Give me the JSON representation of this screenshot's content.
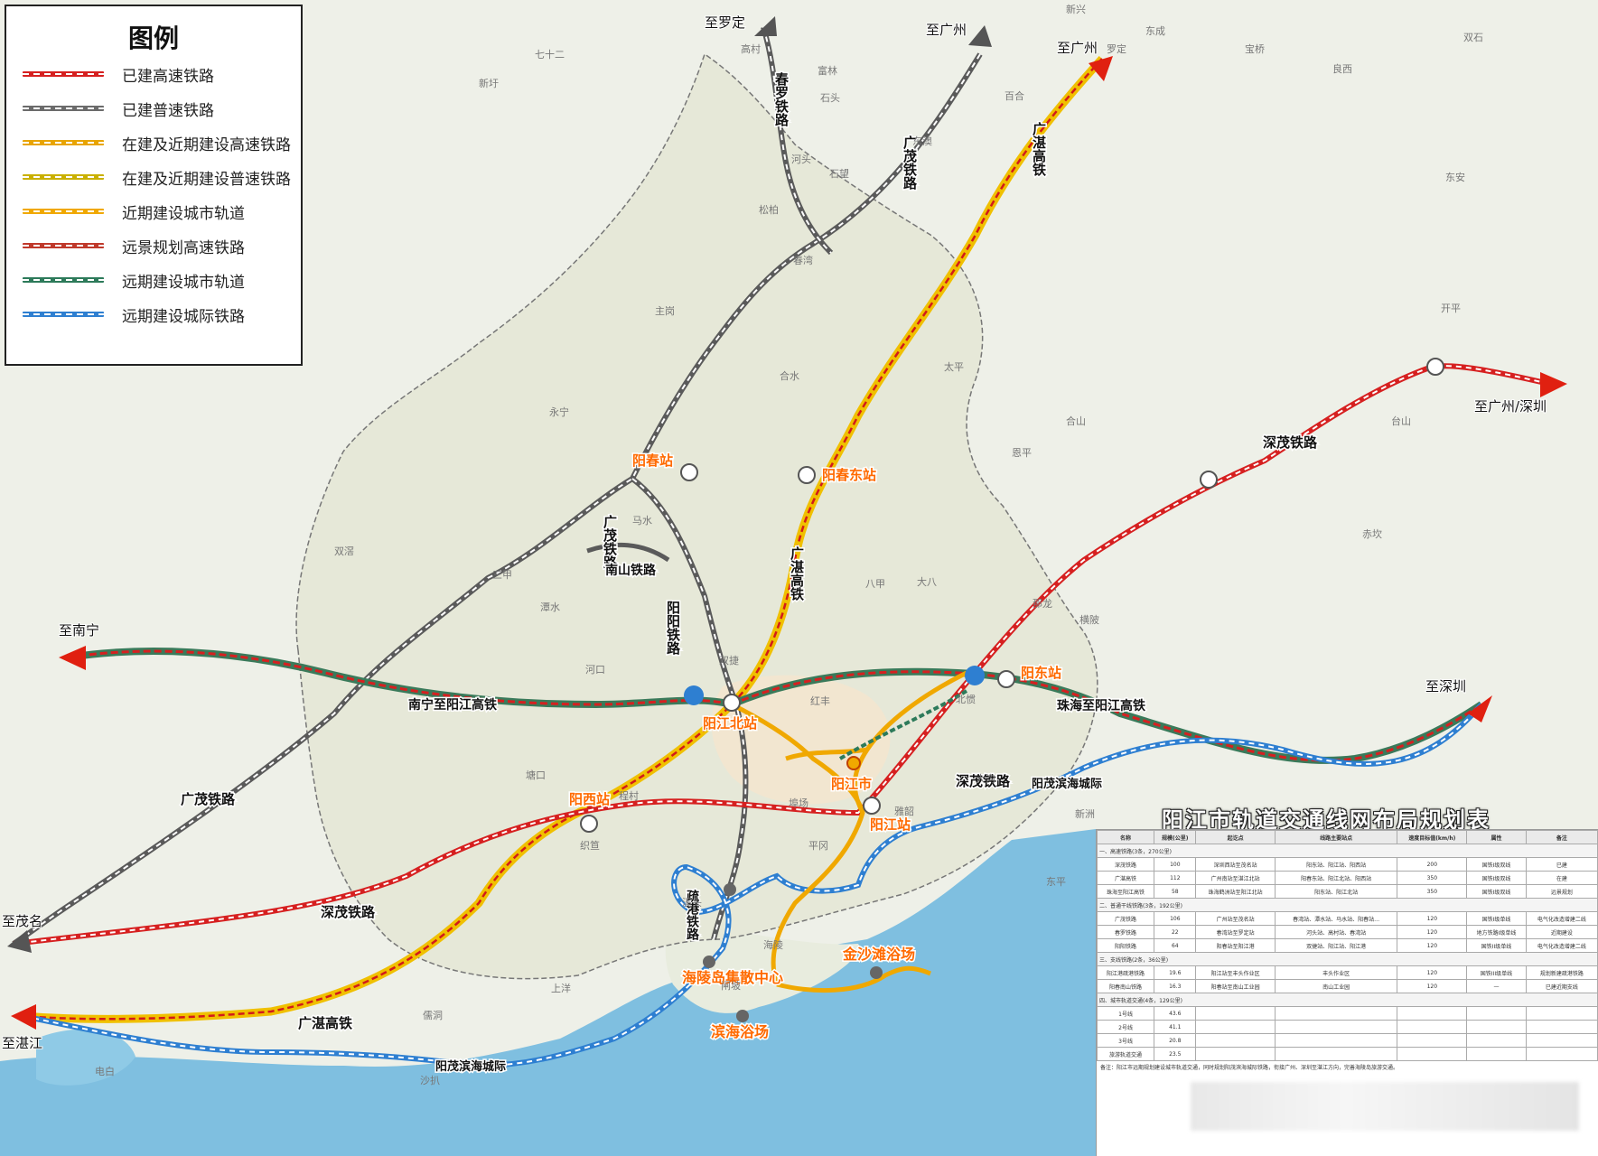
{
  "legend": {
    "title": "图例",
    "items": [
      {
        "label": "已建高速铁路",
        "color": "#d62020"
      },
      {
        "label": "已建普速铁路",
        "color": "#6b6b6b"
      },
      {
        "label": "在建及近期建设高速铁路",
        "color": "#e8a400"
      },
      {
        "label": "在建及近期建设普速铁路",
        "color": "#c9b000"
      },
      {
        "label": "近期建设城市轨道",
        "color": "#f0a800"
      },
      {
        "label": "远景规划高速铁路",
        "color": "#c0392b"
      },
      {
        "label": "远期建设城市轨道",
        "color": "#2d7a5a"
      },
      {
        "label": "远期建设城际铁路",
        "color": "#2e7fd1"
      }
    ]
  },
  "stations": {
    "yangchun": "阳春站",
    "yangchun_east": "阳春东站",
    "yangjiang_north": "阳江北站",
    "yangdong": "阳东站",
    "yangxi": "阳西站",
    "yangjiang": "阳江站",
    "city": "阳江市",
    "hailing_center": "海陵岛集散中心",
    "jinshatan": "金沙滩浴场",
    "binhai": "滨海浴场"
  },
  "destinations": {
    "luoding": "至罗定",
    "guangzhou_a": "至广州",
    "guangzhou_b": "至广州",
    "guangzhou_shenzhen": "至广州/深圳",
    "nanning": "至南宁",
    "shenzhen": "至深圳",
    "maoming": "至茂名",
    "zhanjiang": "至湛江"
  },
  "railway_names": {
    "chunluo": "春罗铁路",
    "guangmao_north": "广茂铁路",
    "guangzhan_north": "广湛高铁",
    "guangmao_west": "广茂铁路",
    "nanshan": "南山铁路",
    "yangyang": "阳阳铁路",
    "guangzhan_mid": "广湛高铁",
    "nanning_yangjiang": "南宁至阳江高铁",
    "zhuhai_yangjiang": "珠海至阳江高铁",
    "shenmao_east": "深茂铁路",
    "shenmao_north": "深茂铁路",
    "shenmao_west": "深茂铁路",
    "guangmao_sw": "广茂铁路",
    "guangzhan_south": "广湛高铁",
    "yangmao_binhai_east": "阳茂滨海城际",
    "yangmao_binhai_west": "阳茂滨海城际",
    "shugang": "疏港铁路"
  },
  "towns": [
    "新兴",
    "东成",
    "罗定",
    "高村",
    "富林",
    "石头",
    "七十二",
    "宝桥",
    "双石",
    "新圩",
    "河头",
    "春湾",
    "松柏",
    "石望",
    "东澳",
    "百合",
    "良西",
    "东安",
    "开平",
    "主岗",
    "合水",
    "永宁",
    "双捷",
    "北惯",
    "红丰",
    "塘口",
    "潭水",
    "三甲",
    "八甲",
    "大八",
    "河口",
    "程村",
    "织笪",
    "溪头",
    "上洋",
    "埠场",
    "平冈",
    "海陵",
    "闸坡",
    "新洲",
    "儒洞",
    "沙扒",
    "电白",
    "大沟",
    "雅韶",
    "合山",
    "赤坎",
    "那龙",
    "恩平",
    "台山",
    "双滘",
    "马水",
    "东平",
    "横陂",
    "太平"
  ],
  "table": {
    "title": "阳江市轨道交通线网布局规划表",
    "headers": [
      "名称",
      "规模(公里)",
      "起讫点",
      "线路主要站点",
      "速度目标值(km/h)",
      "属性",
      "备注"
    ],
    "sections": [
      {
        "title": "一、高速铁路(3条，270公里)",
        "rows": [
          [
            "深茂铁路",
            "100",
            "深圳西站至茂名站",
            "阳东站、阳江站、阳西站",
            "200",
            "国铁I级双线",
            "已建"
          ],
          [
            "广湛高铁",
            "112",
            "广州南站至湛江北站",
            "阳春东站、阳江北站、阳西站",
            "350",
            "国铁I级双线",
            "在建"
          ],
          [
            "珠海至阳江高铁",
            "58",
            "珠海鹤洲站至阳江北站",
            "阳东站、阳江北站",
            "350",
            "国铁I级双线",
            "远景规划"
          ]
        ]
      },
      {
        "title": "二、普通干线铁路(3条，192公里)",
        "rows": [
          [
            "广茂铁路",
            "106",
            "广州站至茂名站",
            "春湾站、潭水站、马水站、阳春站…",
            "120",
            "国铁I级单线",
            "电气化改造增建二线"
          ],
          [
            "春罗铁路",
            "22",
            "春湾站至罗定站",
            "河头站、高村站、春湾站",
            "120",
            "地方铁路I级单线",
            "近期建设"
          ],
          [
            "阳阳铁路",
            "64",
            "阳春站至阳江港",
            "双捷站、阳江站、阳江港",
            "120",
            "国铁II级单线",
            "电气化改造增建二线"
          ]
        ]
      },
      {
        "title": "三、支线铁路(2条，36公里)",
        "rows": [
          [
            "阳江港疏港铁路",
            "19.6",
            "阳江站至丰头作业区",
            "丰头作业区",
            "120",
            "国铁III级单线",
            "规划新建疏港铁路"
          ],
          [
            "阳春南山铁路",
            "16.3",
            "阳春站至南山工业园",
            "南山工业园",
            "120",
            "—",
            "已建近期支线"
          ]
        ]
      },
      {
        "title": "四、城市轨道交通(4条，129公里)",
        "rows": [
          [
            "1号线",
            "43.6",
            "",
            "",
            "",
            "",
            ""
          ],
          [
            "2号线",
            "41.1",
            "",
            "",
            "",
            "",
            ""
          ],
          [
            "3号线",
            "20.8",
            "",
            "",
            "",
            "",
            ""
          ],
          [
            "旅游轨道交通",
            "23.5",
            "",
            "",
            "",
            "",
            ""
          ]
        ]
      }
    ],
    "note": "备注：阳江市远期规划建设城市轨道交通，同时规划阳茂滨海城际铁路，衔接广州、深圳至湛江方向，完善海陵岛旅游交通。"
  }
}
